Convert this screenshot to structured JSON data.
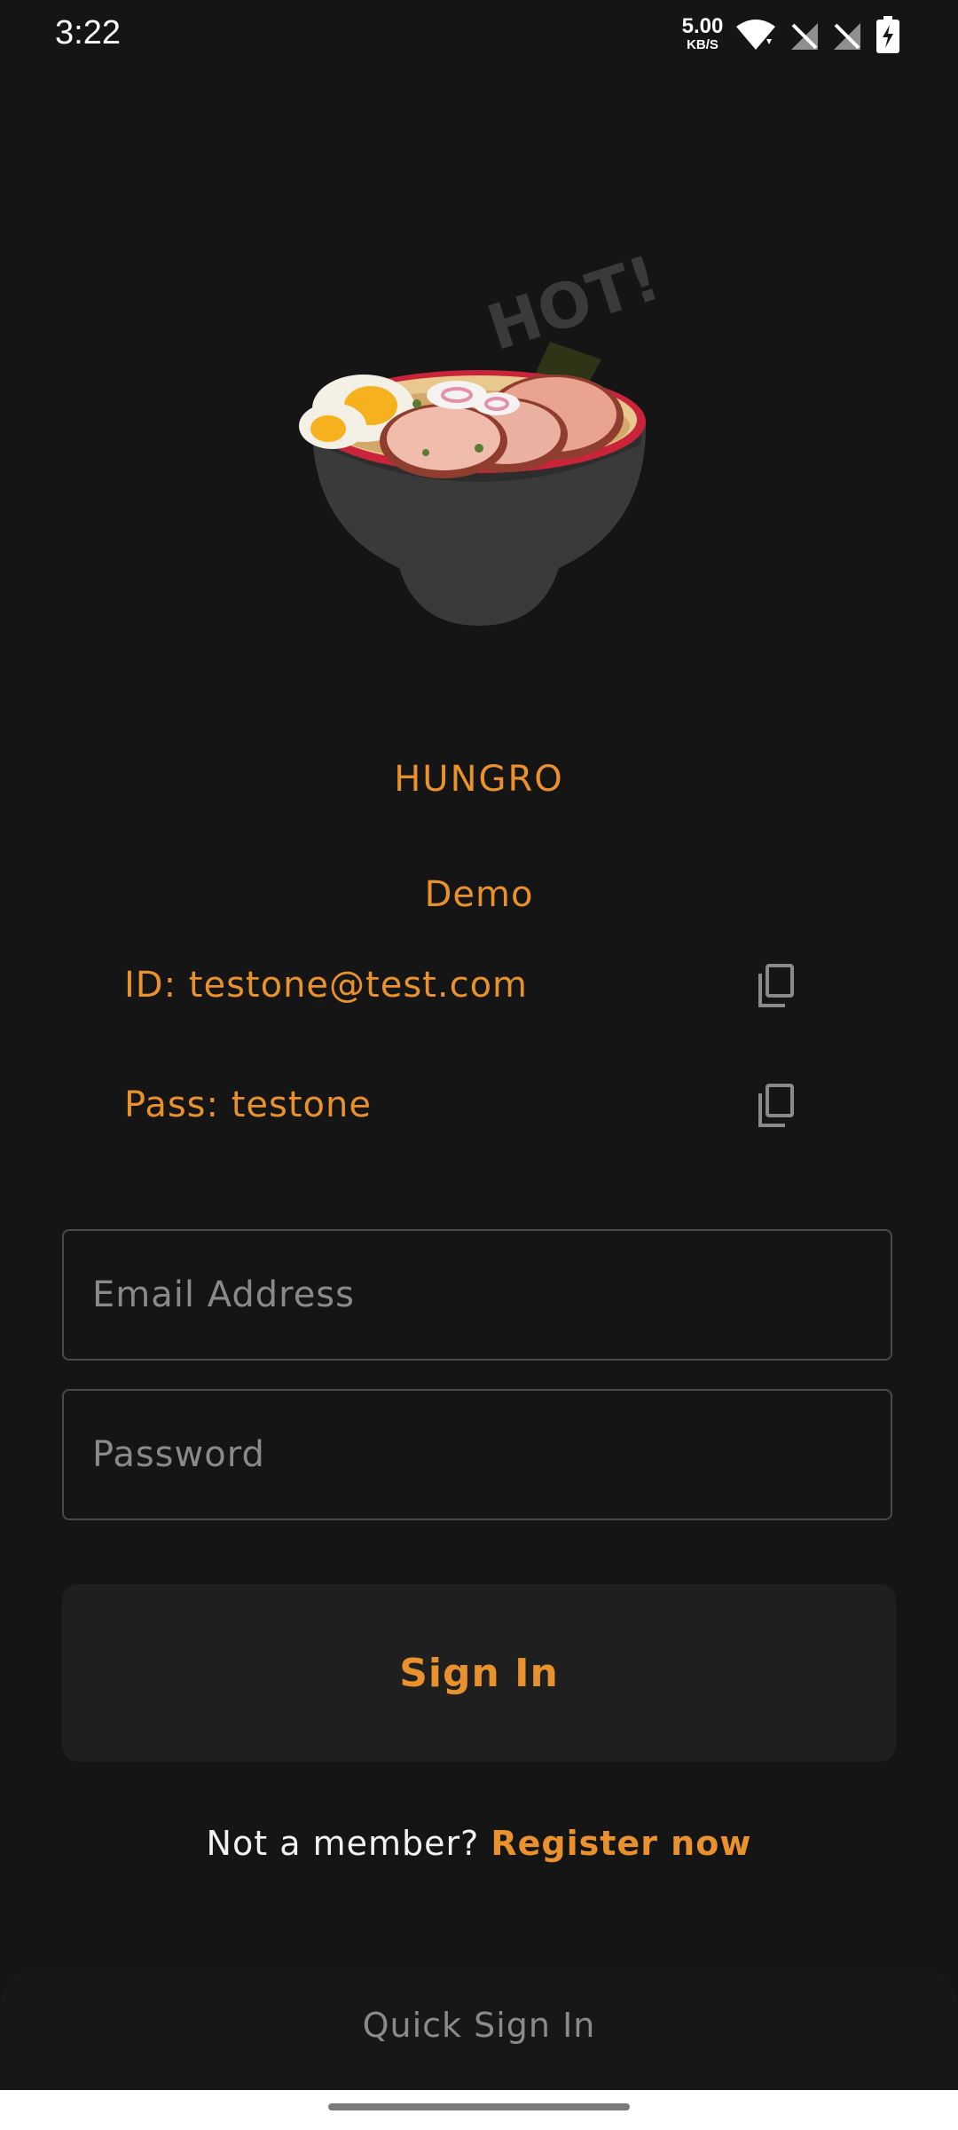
{
  "status_bar": {
    "time": "3:22",
    "net_speed": "5.00",
    "net_unit": "KB/S",
    "icons": [
      "wifi-icon",
      "no-sim-icon",
      "no-sim-icon",
      "battery-charging-icon"
    ]
  },
  "hero": {
    "image": "ramen-bowl-illustration",
    "text": "HOT!"
  },
  "brand": {
    "name": "HUNGRO"
  },
  "demo": {
    "title": "Demo",
    "id_label": "ID: testone@test.com",
    "pass_label": "Pass: testone",
    "copy_icon": "copy-icon"
  },
  "form": {
    "email_placeholder": "Email Address",
    "email_value": "",
    "password_placeholder": "Password",
    "password_value": ""
  },
  "actions": {
    "signin_label": "Sign In",
    "register_prompt": "Not a member?",
    "register_link": "Register now",
    "quick_signin": "Quick Sign In"
  },
  "colors": {
    "background": "#151515",
    "accent": "#e9912c",
    "button_bg": "#1f1f1f",
    "border": "#4a4a4a",
    "muted": "#8a8a8a"
  }
}
